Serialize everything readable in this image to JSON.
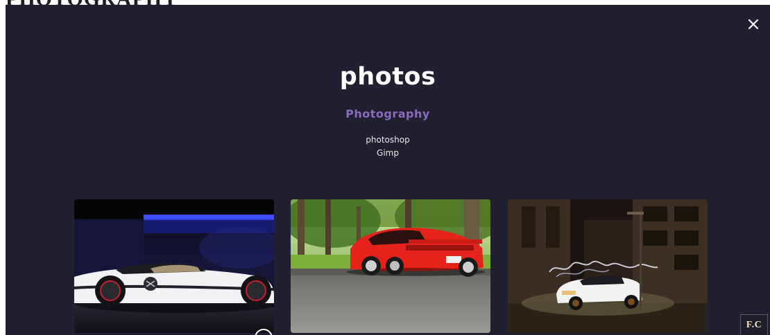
{
  "page": {
    "background_heading": "PHOTOGRAPHY"
  },
  "modal": {
    "title": "photos",
    "category": "Photography",
    "tools": [
      "photoshop",
      "Gimp"
    ],
    "close_icon": "close-icon",
    "photos": [
      {
        "subject": "white-concept-race-car"
      },
      {
        "subject": "red-sports-car-in-park"
      },
      {
        "subject": "white-muscle-car-light-painting"
      }
    ]
  },
  "logo": {
    "text": "F.C"
  },
  "colors": {
    "modal_background": "#202030",
    "accent_purple": "#8a6bc0",
    "title_text": "#ffffff"
  }
}
